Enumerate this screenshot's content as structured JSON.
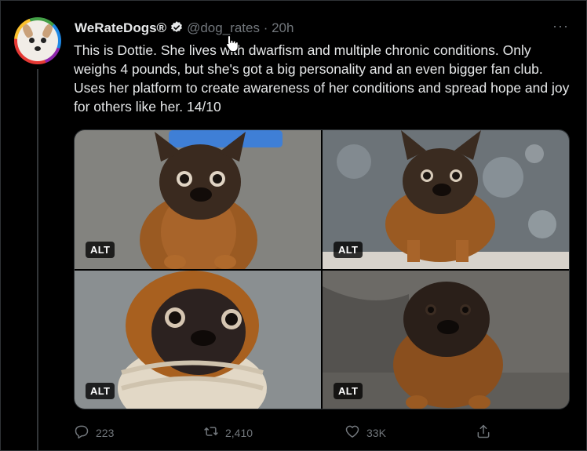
{
  "account": {
    "name": "WeRateDogs®",
    "handle": "@dog_rates",
    "separator": "·",
    "time": "20h"
  },
  "more_label": "···",
  "tweet": {
    "text": "This is Dottie. She lives with dwarfism and multiple chronic conditions. Only weighs 4 pounds, but she's got a big personality and an even bigger fan club. Uses her platform to create awareness of her conditions and spread hope and joy for others like her. 14/10"
  },
  "media": [
    {
      "alt_label": "ALT"
    },
    {
      "alt_label": "ALT"
    },
    {
      "alt_label": "ALT"
    },
    {
      "alt_label": "ALT"
    }
  ],
  "actions": {
    "replies": "223",
    "retweets": "2,410",
    "likes": "33K"
  },
  "colors": {
    "background": "#000000",
    "text": "#e7e9ea",
    "muted": "#71767b",
    "border": "#2f3336"
  },
  "icons": [
    "verified-badge-icon",
    "more-icon",
    "reply-icon",
    "retweet-icon",
    "like-icon",
    "share-icon",
    "pointer-cursor-icon"
  ]
}
